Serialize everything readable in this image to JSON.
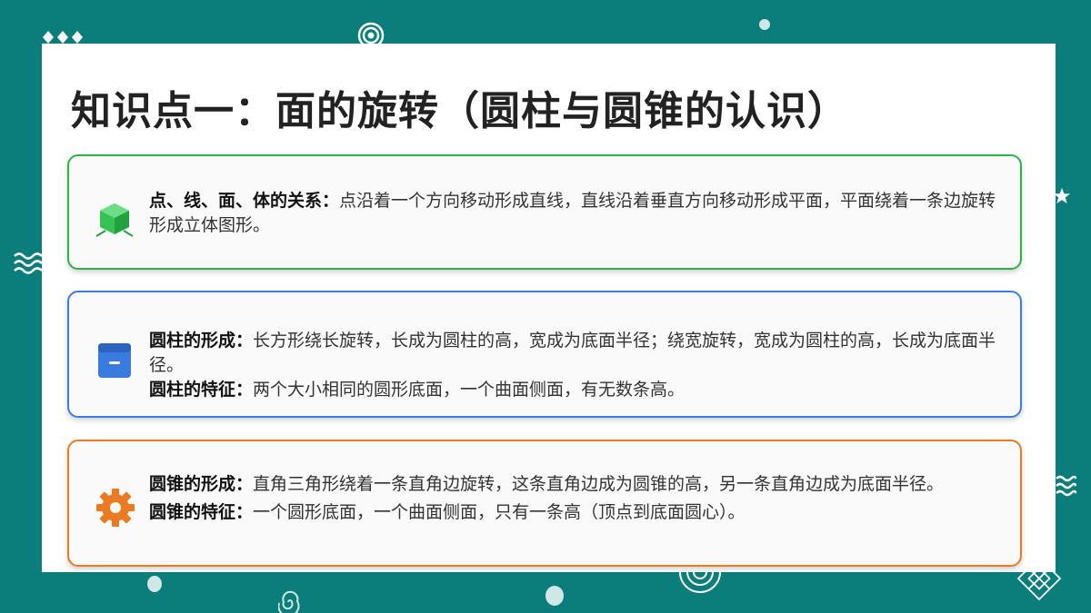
{
  "title": "知识点一：面的旋转（圆柱与圆锥的认识）",
  "cards": [
    {
      "icon": "cube-icon",
      "color": "#2db34a",
      "paragraphs": [
        {
          "key": "点、线、面、体的关系：",
          "text": "点沿着一个方向移动形成直线，直线沿着垂直方向移动形成平面，平面绕着一条边旋转形成立体图形。"
        }
      ]
    },
    {
      "icon": "box-icon",
      "color": "#3b7ddd",
      "paragraphs": [
        {
          "key": "圆柱的形成：",
          "text": "长方形绕长旋转，长成为圆柱的高，宽成为底面半径；绕宽旋转，宽成为圆柱的高，长成为底面半径。"
        },
        {
          "key": "圆柱的特征：",
          "text": "两个大小相同的圆形底面，一个曲面侧面，有无数条高。"
        }
      ]
    },
    {
      "icon": "gear-icon",
      "color": "#ec7a22",
      "paragraphs": [
        {
          "key": "圆锥的形成：",
          "text": "直角三角形绕着一条直角边旋转，这条直角边成为圆锥的高，另一条直角边成为底面半径。"
        },
        {
          "key": "圆锥的特征：",
          "text": "一个圆形底面，一个曲面侧面，只有一条高（顶点到底面圆心）。"
        }
      ]
    }
  ],
  "background_color": "#0b7d7b"
}
